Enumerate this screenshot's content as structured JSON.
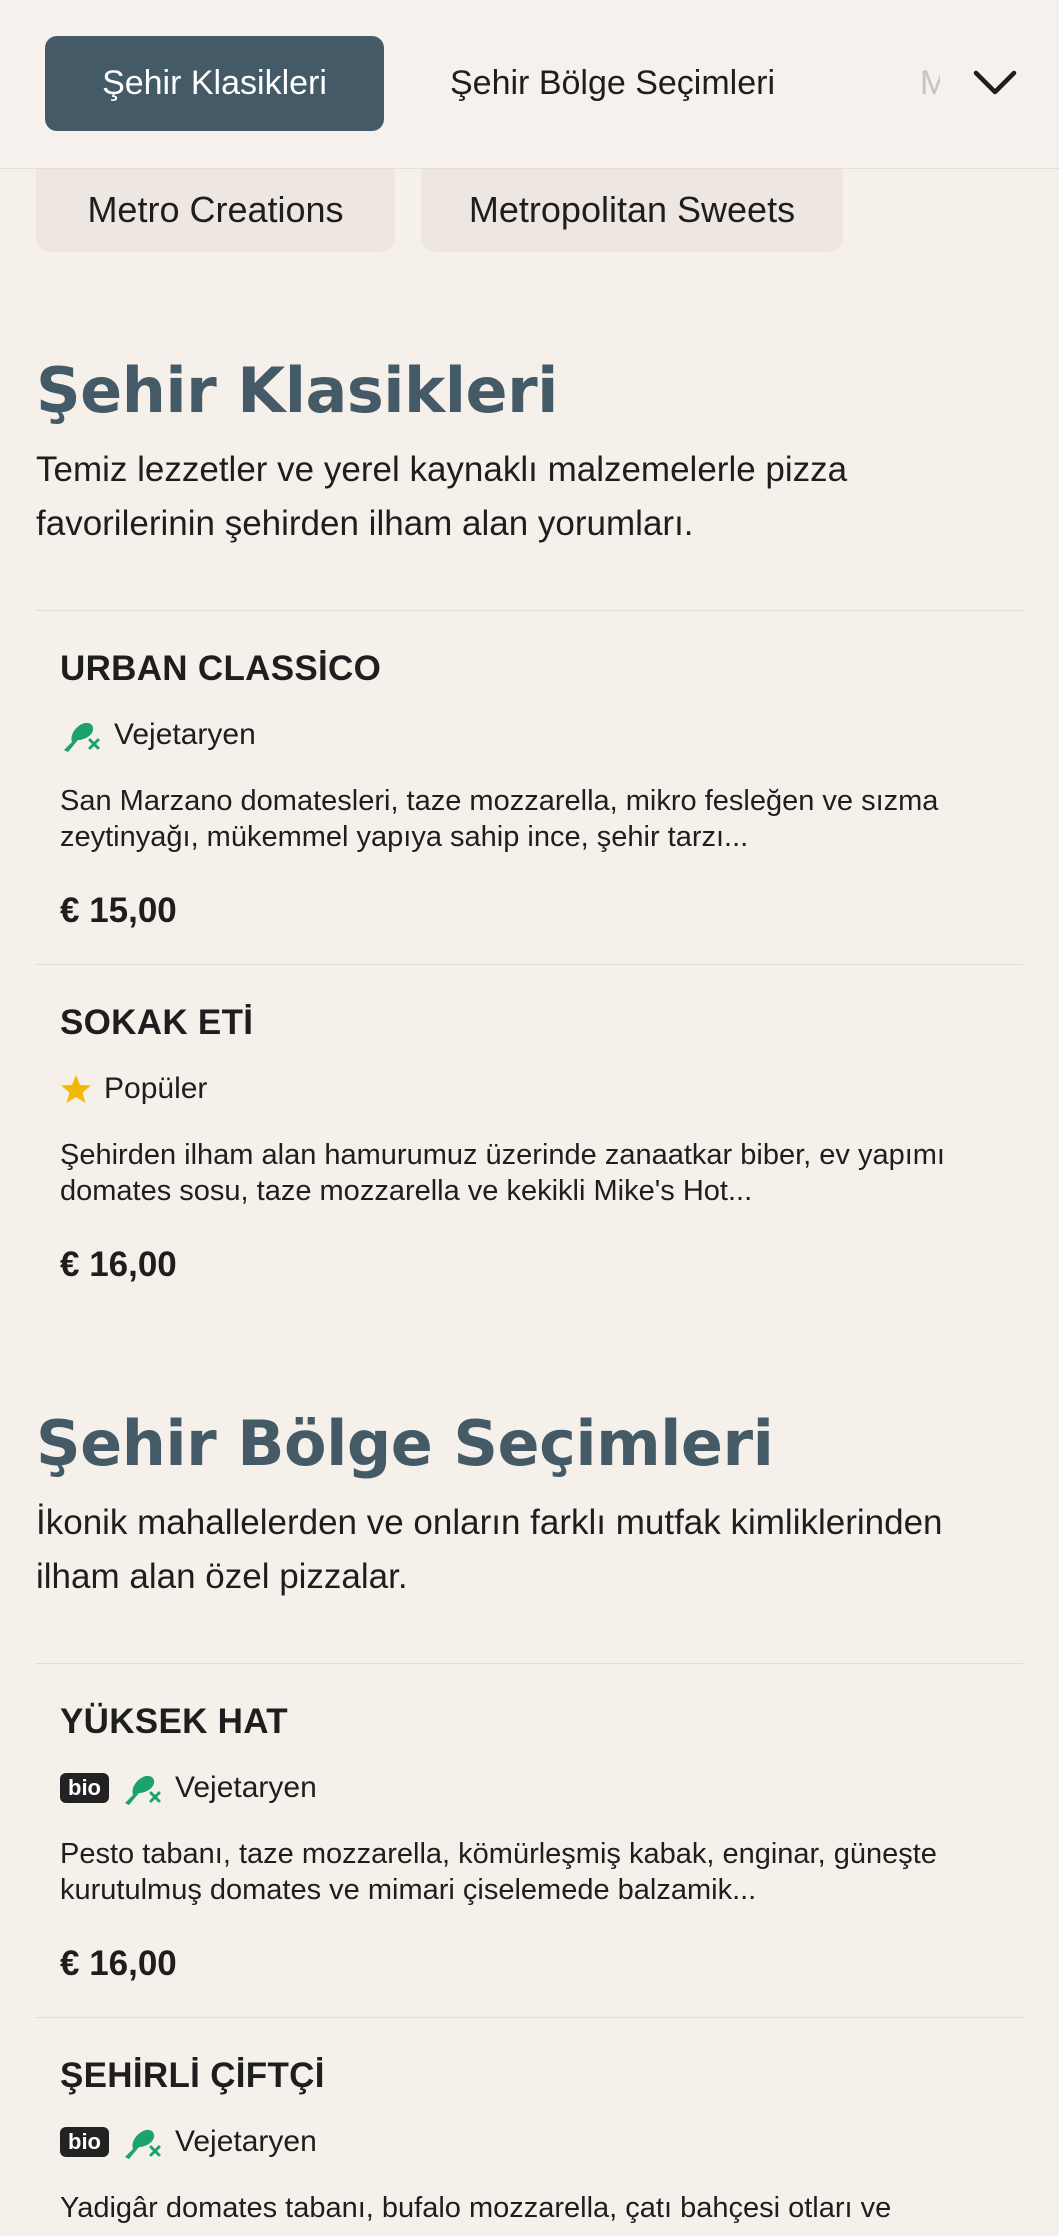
{
  "nav": {
    "active_tab": "Şehir Klasikleri",
    "tabs": [
      "Şehir Bölge Seçimleri",
      "M"
    ],
    "more_icon": "chevron-down-icon",
    "subtabs": [
      "Metro Creations",
      "Metropolitan Sweets"
    ]
  },
  "sections": [
    {
      "title": "Şehir Klasikleri",
      "description": "Temiz lezzetler ve yerel kaynaklı malzemelerle pizza favorilerinin şehirden ilham alan yorumları.",
      "items": [
        {
          "name": "URBAN CLASSİCO",
          "tag": "Vejetaryen",
          "tag_icon": "vegetarian-icon",
          "description": "San Marzano domatesleri, taze mozzarella, mikro fesleğen ve sızma zeytinyağı, mükemmel yapıya sahip ince, şehir tarzı...",
          "price": "€ 15,00"
        },
        {
          "name": "SOKAK ETİ",
          "tag": "Popüler",
          "tag_icon": "star-icon",
          "description": "Şehirden ilham alan hamurumuz üzerinde zanaatkar biber, ev yapımı domates sosu, taze mozzarella ve kekikli Mike's Hot...",
          "price": "€ 16,00"
        }
      ]
    },
    {
      "title": "Şehir Bölge Seçimleri",
      "description": "İkonik mahallelerden ve onların farklı mutfak kimliklerinden ilham alan özel pizzalar.",
      "items": [
        {
          "name": "YÜKSEK HAT",
          "badge": "bio",
          "tag": "Vejetaryen",
          "tag_icon": "vegetarian-icon",
          "description": "Pesto tabanı, taze mozzarella, kömürleşmiş kabak, enginar, güneşte kurutulmuş domates ve mimari çiselemede balzamik...",
          "price": "€ 16,00"
        },
        {
          "name": "ŞEHİRLİ ÇİFTÇİ",
          "badge": "bio",
          "tag": "Vejetaryen",
          "tag_icon": "vegetarian-icon",
          "description": "Yadigâr domates tabanı, bufalo mozzarella, çatı bahçesi otları ve"
        }
      ]
    }
  ],
  "colors": {
    "background": "#f6f0eb",
    "accent": "#445a67",
    "vegetarian": "#1aa36a",
    "star": "#f5b800"
  }
}
